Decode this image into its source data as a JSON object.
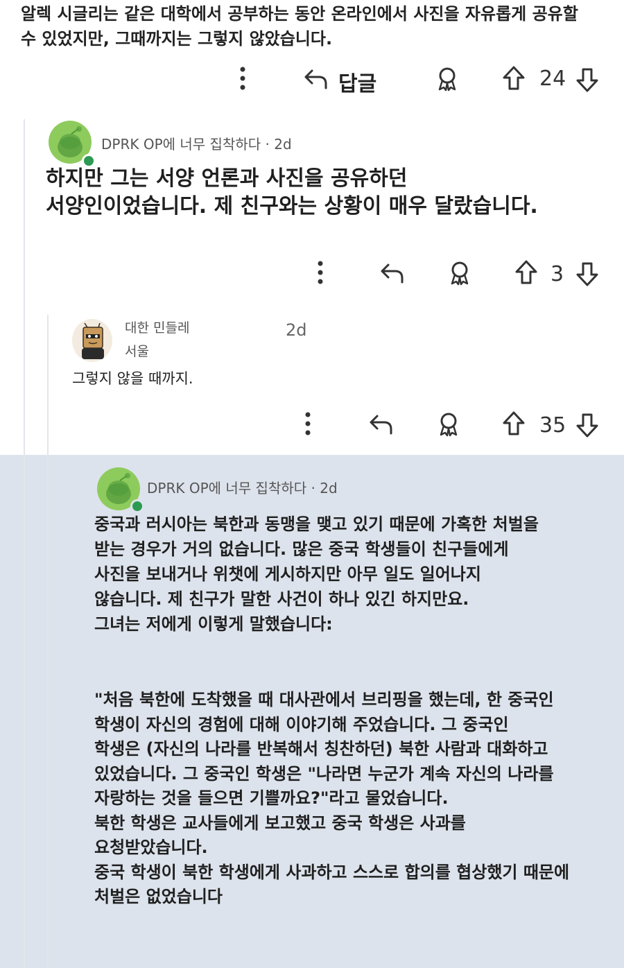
{
  "top_comment": {
    "lines": [
      "알렉 시글리는 같은 대학에서 공부하는 동안 온라인에서 사진을 자유롭게 공유할",
      "수 있었지만, 그때까지는 그렇지 않았습니다."
    ],
    "actions": {
      "more_icon": "more-vertical-icon",
      "reply_label": "답글",
      "award_icon": "award-icon",
      "score": "24"
    }
  },
  "reply1": {
    "author_meta": "DPRK OP에 너무 집착하다 · 2d",
    "lines": [
      "하지만 그는 서양 언론과 사진을 공유하던",
      "서양인이었습니다. 제 친구와는 상황이 매우 달랐습니다."
    ],
    "actions": {
      "score": "3"
    }
  },
  "reply2": {
    "author": "대한 민들레",
    "flair": "서울",
    "time": "2d",
    "text": "그렇지 않을 때까지.",
    "actions": {
      "score": "35"
    }
  },
  "reply3": {
    "author_meta": "DPRK OP에 너무 집착하다 · 2d",
    "paragraph1": [
      "중국과 러시아는 북한과 동맹을 맺고 있기 때문에 가혹한 처벌을",
      "받는 경우가 거의 없습니다. 많은 중국 학생들이 친구들에게",
      "사진을 보내거나 위챗에 게시하지만 아무 일도 일어나지",
      "않습니다. 제 친구가 말한 사건이 하나 있긴 하지만요.",
      "그녀는 저에게 이렇게 말했습니다:"
    ],
    "paragraph2": [
      "\"처음 북한에 도착했을 때 대사관에서 브리핑을 했는데, 한 중국인",
      "학생이 자신의 경험에 대해 이야기해 주었습니다. 그 중국인",
      "학생은 (자신의 나라를 반복해서 칭찬하던) 북한 사람과 대화하고",
      "있었습니다. 그 중국인 학생은 \"나라면 누군가 계속 자신의 나라를",
      "자랑하는 것을 들으면 기쁠까요?\"라고 물었습니다.",
      "북한 학생은 교사들에게 보고했고 중국 학생은 사과를",
      "요청받았습니다.",
      "중국 학생이 북한 학생에게 사과하고 스스로 합의를 협상했기 때문에",
      "처벌은 없었습니다"
    ]
  },
  "colors": {
    "online": "#2c9a52",
    "snoo_bg": "#8ecb5d",
    "highlight_bg": "#dde3ec",
    "thread_line": "#e3e6ea"
  }
}
